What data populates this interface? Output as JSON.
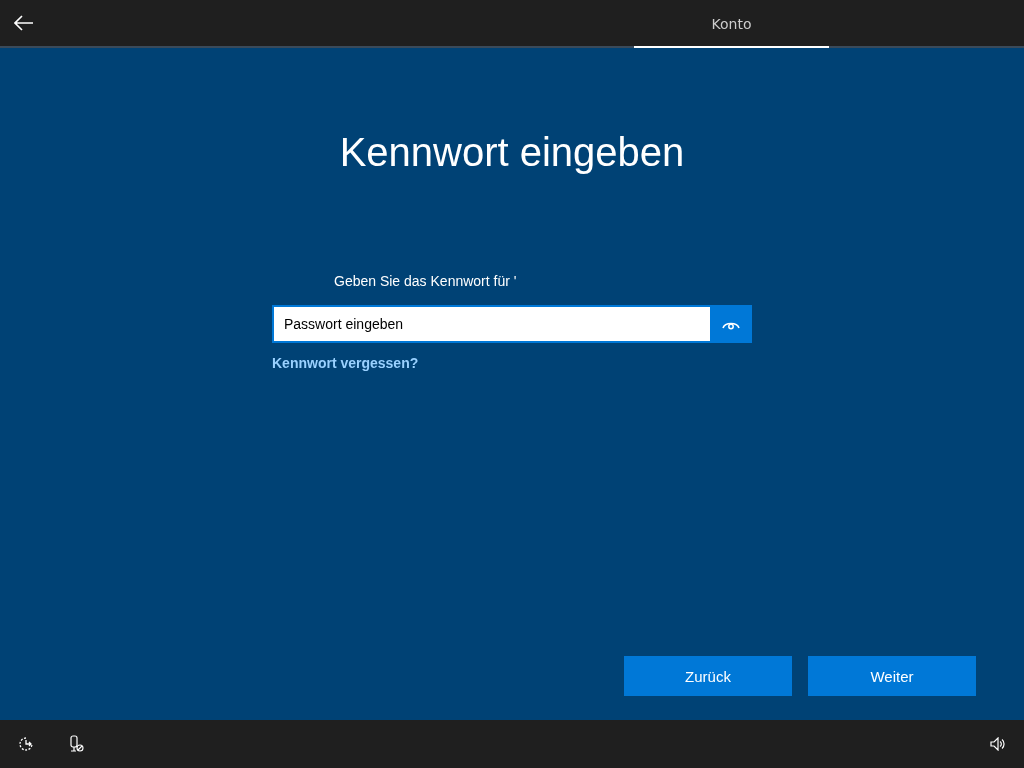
{
  "top_bar": {
    "tabs": [
      {
        "label": "Konto",
        "selected": true
      }
    ]
  },
  "title": "Kennwort eingeben",
  "prompt": "Geben Sie das Kennwort für '",
  "password_field": {
    "placeholder": "Passwort eingeben"
  },
  "forgot_link": "Kennwort vergessen?",
  "buttons": [
    {
      "label": "Zurück"
    },
    {
      "label": "Weiter"
    }
  ]
}
